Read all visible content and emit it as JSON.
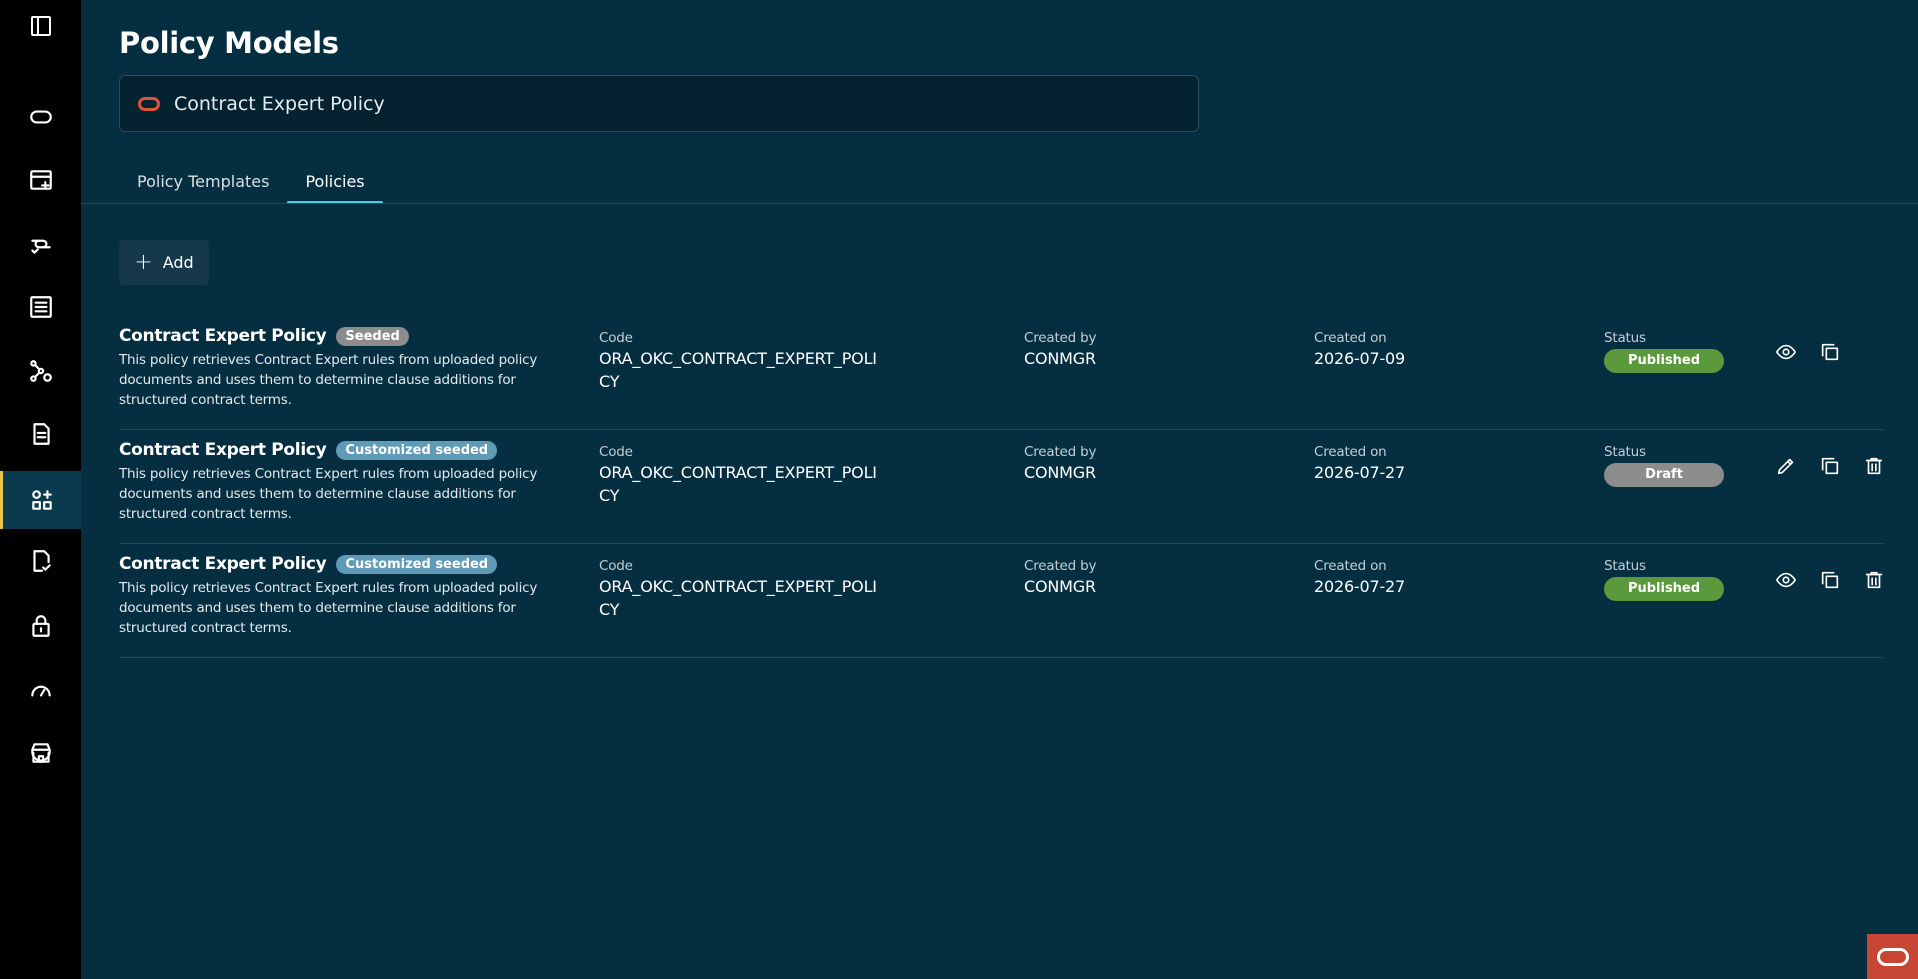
{
  "header": {
    "title": "Policy Models"
  },
  "selector": {
    "value": "Contract Expert Policy"
  },
  "tabs": [
    {
      "label": "Policy Templates",
      "active": false
    },
    {
      "label": "Policies",
      "active": true
    }
  ],
  "toolbar": {
    "add_label": "Add"
  },
  "columns": {
    "code": "Code",
    "created_by": "Created by",
    "created_on": "Created on",
    "status": "Status"
  },
  "policies": [
    {
      "name": "Contract Expert Policy",
      "badge": "Seeded",
      "description": "This policy retrieves Contract Expert rules from uploaded policy documents and uses them to determine clause additions for structured contract terms.",
      "code": "ORA_OKC_CONTRACT_EXPERT_POLICY",
      "created_by": "CONMGR",
      "created_on": "2026-07-09",
      "status": "Published"
    },
    {
      "name": "Contract Expert Policy",
      "badge": "Customized seeded",
      "description": "This policy retrieves Contract Expert rules from uploaded policy documents and uses them to determine clause additions for structured contract terms.",
      "code": "ORA_OKC_CONTRACT_EXPERT_POLICY",
      "created_by": "CONMGR",
      "created_on": "2026-07-27",
      "status": "Draft"
    },
    {
      "name": "Contract Expert Policy",
      "badge": "Customized seeded",
      "description": "This policy retrieves Contract Expert rules from uploaded policy documents and uses them to determine clause additions for structured contract terms.",
      "code": "ORA_OKC_CONTRACT_EXPERT_POLICY",
      "created_by": "CONMGR",
      "created_on": "2026-07-27",
      "status": "Published"
    }
  ],
  "colors": {
    "background": "#052e40",
    "rail": "#000000",
    "accent_tab": "#4bd0e0",
    "rail_active": "#e8c34a",
    "published": "#5b9a3c",
    "draft": "#8c8c8c",
    "badge_seeded": "#8c8c8c",
    "badge_customized": "#5f9bb6",
    "oracle_red": "#c74634"
  },
  "icons": {
    "rail": [
      "panel-toggle-icon",
      "oracle-ring-icon",
      "calendar-add-icon",
      "link-check-icon",
      "list-icon",
      "network-settings-icon",
      "document-icon",
      "apps-add-icon",
      "document-check-icon",
      "lock-icon",
      "gauge-icon",
      "store-icon"
    ],
    "row_actions": [
      "eye-icon",
      "copy-icon",
      "pencil-icon",
      "trash-icon"
    ]
  }
}
